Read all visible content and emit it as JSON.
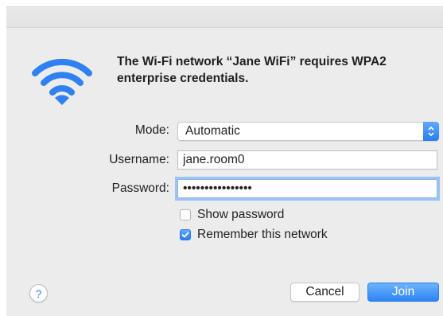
{
  "dialog": {
    "title": "The Wi-Fi network “Jane WiFi” requires WPA2 enterprise credentials.",
    "icon": "wifi-icon",
    "accent_color": "#2f80f1"
  },
  "form": {
    "mode_label": "Mode:",
    "mode_value": "Automatic",
    "username_label": "Username:",
    "username_value": "jane.room0",
    "password_label": "Password:",
    "password_value": "••••••••••••••••"
  },
  "options": {
    "show_password_label": "Show password",
    "show_password_checked": false,
    "remember_label": "Remember this network",
    "remember_checked": true
  },
  "footer": {
    "help_label": "?",
    "cancel_label": "Cancel",
    "join_label": "Join"
  }
}
